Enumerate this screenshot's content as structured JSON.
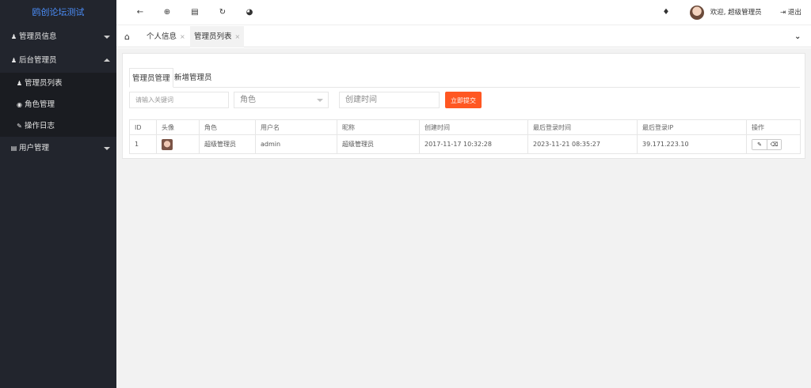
{
  "app": {
    "title": "鸥创论坛测试"
  },
  "sidebar": {
    "items": [
      {
        "label": "管理员信息",
        "icon": "user-icon",
        "expanded": false
      },
      {
        "label": "后台管理员",
        "icon": "user-icon",
        "expanded": true,
        "children": [
          {
            "label": "管理员列表",
            "icon": "user-icon"
          },
          {
            "label": "角色管理",
            "icon": "target-icon"
          },
          {
            "label": "操作日志",
            "icon": "pencil-icon"
          }
        ]
      },
      {
        "label": "用户管理",
        "icon": "id-card-icon",
        "expanded": false
      }
    ]
  },
  "header": {
    "welcome": "欢迎, 超级管理员",
    "logout": "退出",
    "icons": [
      "back-icon",
      "compass-icon",
      "bank-icon",
      "refresh-icon",
      "globe-icon",
      "tag-icon"
    ]
  },
  "tabs": [
    {
      "label": "个人信息",
      "active": false
    },
    {
      "label": "管理员列表",
      "active": true
    }
  ],
  "panel": {
    "subtabs": [
      "管理员管理",
      "新增管理员"
    ],
    "search": {
      "keyword_placeholder": "请输入关键词",
      "role_placeholder": "角色",
      "time_placeholder": "创建时间",
      "submit_label": "立即提交"
    },
    "table": {
      "headers": [
        "ID",
        "头像",
        "角色",
        "用户名",
        "昵称",
        "创建时间",
        "最后登录时间",
        "最后登录IP",
        "操作"
      ],
      "rows": [
        {
          "id": "1",
          "role": "超级管理员",
          "username": "admin",
          "nickname": "超级管理员",
          "created": "2017-11-17 10:32:28",
          "last_login": "2023-11-21 08:35:27",
          "last_ip": "39.171.223.10"
        }
      ]
    }
  },
  "colors": {
    "sidebar_bg": "#22252d",
    "logo_text": "#4b8df8",
    "submit_btn": "#ff5722"
  }
}
